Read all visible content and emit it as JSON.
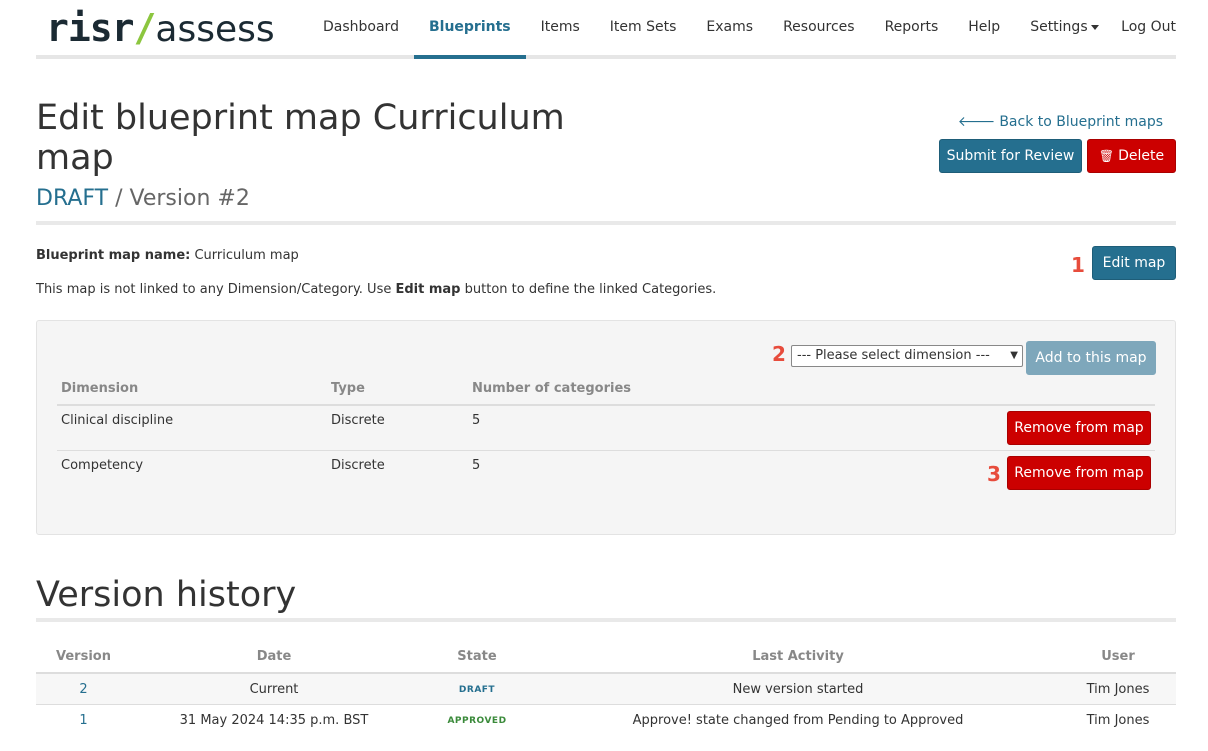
{
  "app": {
    "logo": {
      "left": "risr",
      "slash": "/",
      "right": "assess"
    }
  },
  "nav": {
    "items": [
      {
        "label": "Dashboard"
      },
      {
        "label": "Blueprints"
      },
      {
        "label": "Items"
      },
      {
        "label": "Item Sets"
      },
      {
        "label": "Exams"
      },
      {
        "label": "Resources"
      },
      {
        "label": "Reports"
      },
      {
        "label": "Help"
      },
      {
        "label": "Settings"
      }
    ],
    "active": "Blueprints",
    "logout": "Log Out"
  },
  "page": {
    "title": "Edit blueprint map Curriculum map",
    "state": "DRAFT",
    "version": "/ Version #2",
    "back_link": "Back to Blueprint maps",
    "submit_label": "Submit for Review",
    "delete_label": "Delete"
  },
  "map_info": {
    "name_label": "Blueprint map name:",
    "name_value": "Curriculum map",
    "note_prefix": "This map is not linked to any Dimension/Category. Use",
    "note_bold": "Edit map",
    "note_suffix": "button to define the linked Categories.",
    "edit_label": "Edit map"
  },
  "annotations": [
    "1",
    "2",
    "3"
  ],
  "dimension_panel": {
    "select_placeholder": "--- Please select dimension ---",
    "add_label": "Add to this map",
    "columns": [
      "Dimension",
      "Type",
      "Number of categories"
    ],
    "rows": [
      {
        "dimension": "Clinical discipline",
        "type": "Discrete",
        "count": "5",
        "action": "Remove from map"
      },
      {
        "dimension": "Competency",
        "type": "Discrete",
        "count": "5",
        "action": "Remove from map"
      }
    ]
  },
  "version_history": {
    "title": "Version history",
    "columns": [
      "Version",
      "Date",
      "State",
      "Last Activity",
      "User"
    ],
    "rows": [
      {
        "version": "2",
        "date": "Current",
        "state": "DRAFT",
        "activity": "New version started",
        "user": "Tim Jones"
      },
      {
        "version": "1",
        "date": "31 May 2024 14:35 p.m. BST",
        "state": "APPROVED",
        "activity": "Approve! state changed from Pending to Approved",
        "user": "Tim Jones"
      }
    ]
  },
  "colors": {
    "primary": "#256f8f",
    "danger": "#cc0000",
    "annotation": "#e74c3c",
    "logo_accent": "#8cc63f"
  }
}
